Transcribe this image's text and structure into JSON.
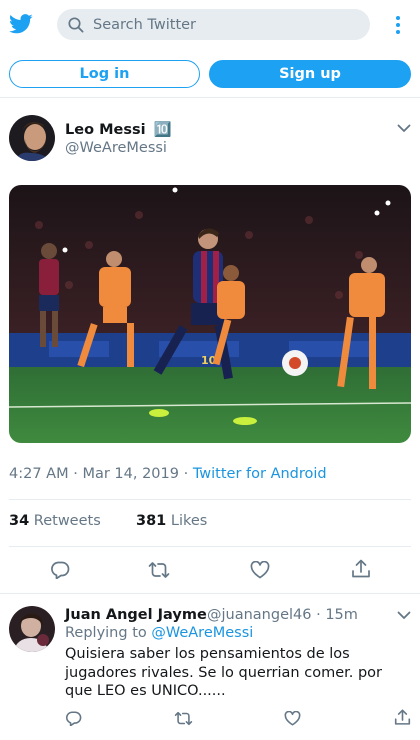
{
  "header": {
    "logo_icon": "twitter-bird-icon",
    "search": {
      "placeholder": "Search Twitter",
      "value": ""
    },
    "menu_icon": "more-vertical-icon",
    "login_label": "Log in",
    "signup_label": "Sign up"
  },
  "colors": {
    "brand": "#1da1f2",
    "link": "#1b95e0",
    "secondary_text": "#657786",
    "divider": "#e6ecf0"
  },
  "tweet": {
    "author": {
      "name": "Leo Messi",
      "badge": "🔟",
      "handle": "@WeAreMessi"
    },
    "time": "4:27 AM",
    "date": "Mar 14, 2019",
    "source": "Twitter for Android",
    "retweet_count": "34",
    "retweet_label": "Retweets",
    "like_count": "381",
    "like_label": "Likes"
  },
  "reply": {
    "author": {
      "name": "Juan Angel Jayme",
      "handle": "@juanangel46",
      "age": "15m"
    },
    "replying_prefix": "Replying to",
    "replying_to": "@WeAreMessi",
    "text": "Quisiera saber los pensamientos de los jugadores rivales.  Se lo querrian comer. por que LEO es UNICO......"
  }
}
